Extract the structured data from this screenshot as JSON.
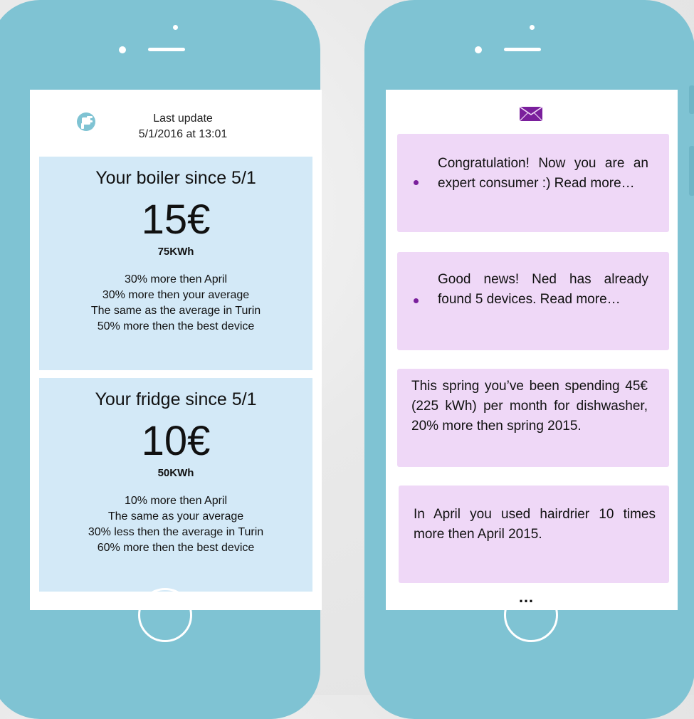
{
  "left_phone": {
    "update_label": "Last update",
    "update_time": "5/1/2016 at 13:01",
    "icon": "plug-icon",
    "devices": [
      {
        "title": "Your boiler since 5/1",
        "cost": "15€",
        "kwh": "75KWh",
        "notes": [
          "30% more then April",
          "30% more then your average",
          "The same as the average in Turin",
          "50% more then the best device"
        ]
      },
      {
        "title": "Your fridge since 5/1",
        "cost": "10€",
        "kwh": "50KWh",
        "notes": [
          "10% more then April",
          "The same as your average",
          "30% less then the average in Turin",
          "60% more then the best device"
        ]
      }
    ]
  },
  "right_phone": {
    "icon": "envelope-icon",
    "messages": [
      {
        "text": "Congratulation! Now you are an expert consumer :) Read more…",
        "bullet": true
      },
      {
        "text": "Good news! Ned has already found 5 devices. Read more…",
        "bullet": true
      },
      {
        "text": "This spring you’ve been spending 45€ (225 kWh) per month for dishwasher, 20% more then spring 2015.",
        "bullet": false
      },
      {
        "text": "In April you used hairdrier 10 times more then April 2015.",
        "bullet": false
      }
    ],
    "more": "…"
  },
  "colors": {
    "phone_body": "#7fc3d3",
    "device_card": "#d3e9f7",
    "message_card": "#efd8f7",
    "accent_purple": "#7a1f9c"
  }
}
